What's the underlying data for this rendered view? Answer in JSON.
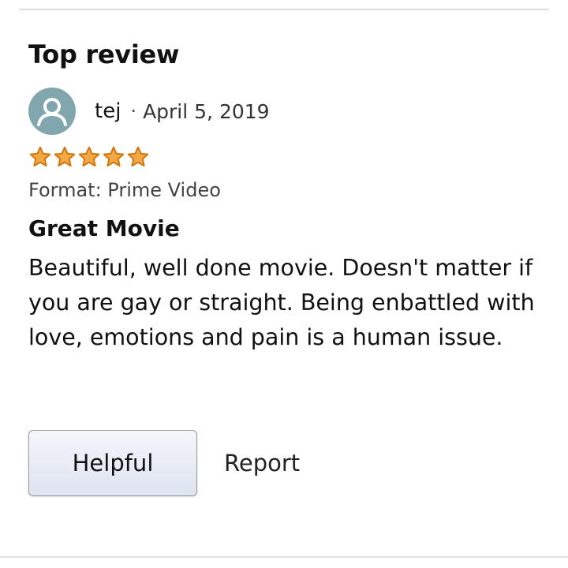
{
  "section": {
    "title": "Top review"
  },
  "review": {
    "reviewer_name": "tej",
    "separator": "·",
    "date": "April 5, 2019",
    "rating": 5,
    "rating_max": 5,
    "format_label": "Format: Prime Video",
    "title": "Great Movie",
    "body": "Beautiful, well done movie. Doesn't matter if you are gay or straight. Being enbattled with love, emotions and pain is a human issue."
  },
  "actions": {
    "helpful_label": "Helpful",
    "report_label": "Report"
  },
  "icons": {
    "avatar": "user-avatar-icon",
    "star": "star-icon"
  },
  "colors": {
    "star_fill": "#f3a847",
    "star_stroke": "#d0780f",
    "avatar_bg": "#81a6ad",
    "button_gradient_top": "#f4f6fb",
    "button_gradient_bottom": "#dde3f0"
  }
}
